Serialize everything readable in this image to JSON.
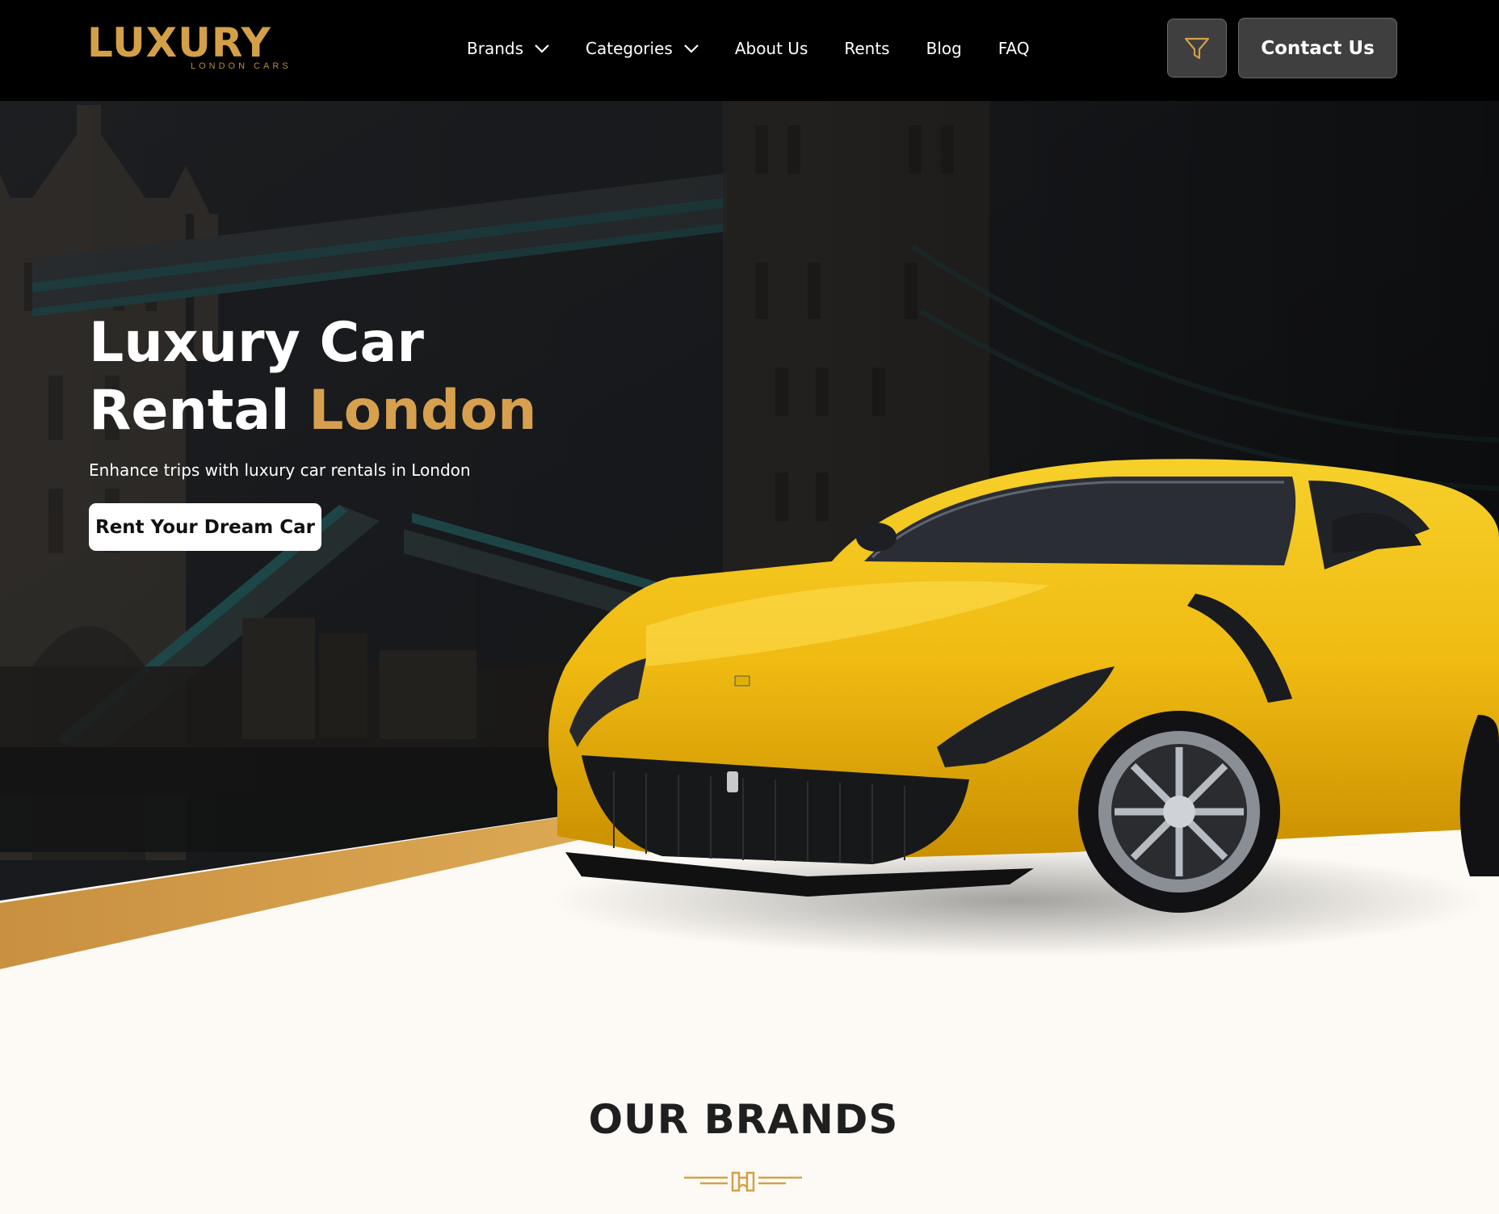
{
  "brand": {
    "logo_text": "LUXURY",
    "logo_subtext": "LONDON CARS",
    "accent_color": "#d4a047"
  },
  "nav": {
    "items": [
      {
        "label": "Brands",
        "has_dropdown": true
      },
      {
        "label": "Categories",
        "has_dropdown": true
      },
      {
        "label": "About Us",
        "has_dropdown": false
      },
      {
        "label": "Rents",
        "has_dropdown": false
      },
      {
        "label": "Blog",
        "has_dropdown": false
      },
      {
        "label": "FAQ",
        "has_dropdown": false
      }
    ]
  },
  "header_actions": {
    "filter_icon": "filter-icon",
    "contact_label": "Contact Us"
  },
  "hero": {
    "title_line1": "Luxury Car",
    "title_line2_plain": "Rental",
    "title_line2_accent": "London",
    "subtitle": "Enhance trips with luxury car rentals in London",
    "cta_label": "Rent Your Dream Car"
  },
  "brands_section": {
    "title": "OUR BRANDS",
    "ornament_icon": "tower-bridge-icon"
  }
}
